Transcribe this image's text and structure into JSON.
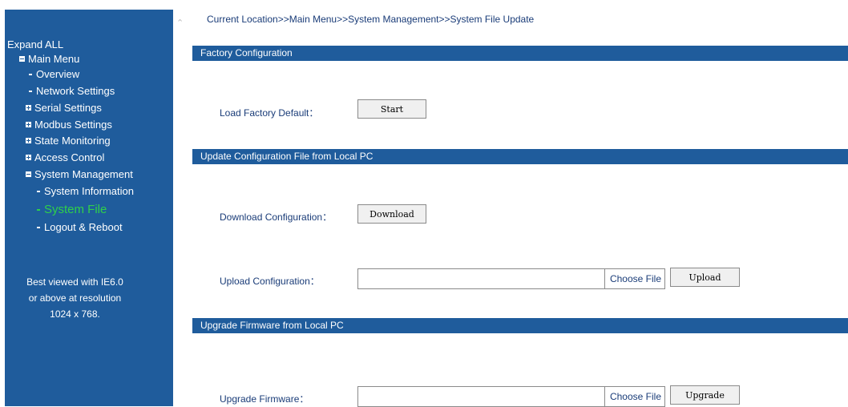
{
  "sidebar": {
    "expand_all": "Expand ALL",
    "main_menu": "Main Menu",
    "items": [
      {
        "label": "Overview"
      },
      {
        "label": "Network Settings"
      },
      {
        "label": "Serial Settings"
      },
      {
        "label": "Modbus Settings"
      },
      {
        "label": "State Monitoring"
      },
      {
        "label": "Access Control"
      },
      {
        "label": "System Management"
      }
    ],
    "subitems": [
      {
        "label": "System Information"
      },
      {
        "label": "System File"
      },
      {
        "label": "Logout & Reboot"
      }
    ],
    "note_lines": [
      "Best viewed with IE6.0",
      "or above at resolution",
      "1024 x 768."
    ]
  },
  "breadcrumb": "Current Location>>Main Menu>>System Management>>System File Update",
  "sections": {
    "factory": {
      "title": "Factory Configuration",
      "load_label": "Load Factory Default：",
      "start_button": "Start"
    },
    "update_config": {
      "title": "Update Configuration File from Local PC",
      "download_label": "Download Configuration：",
      "download_button": "Download",
      "upload_label": "Upload Configuration：",
      "choose_file": "Choose File",
      "upload_button": "Upload"
    },
    "firmware": {
      "title": "Upgrade Firmware from Local PC",
      "upgrade_label": "Upgrade Firmware：",
      "choose_file": "Choose File",
      "upgrade_button": "Upgrade"
    }
  },
  "colors": {
    "sidebar_bg": "#1f5c9c",
    "active_item": "#2fd04a",
    "label_text": "#1a3c78"
  }
}
